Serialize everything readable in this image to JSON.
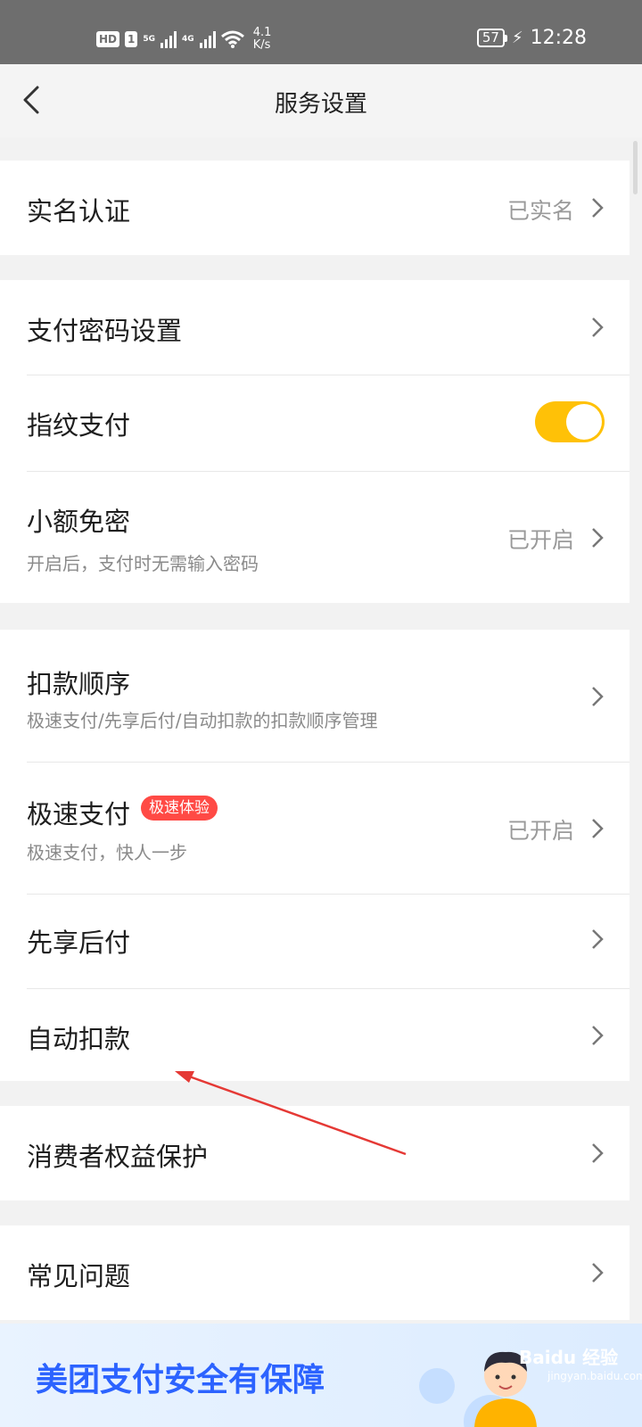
{
  "status_bar": {
    "hd": "HD",
    "sim": "1",
    "net1": "5G",
    "net2": "4G",
    "speed_value": "4.1",
    "speed_unit": "K/s",
    "battery": "57",
    "time": "12:28"
  },
  "header": {
    "title": "服务设置"
  },
  "rows": {
    "realname": {
      "label": "实名认证",
      "value": "已实名"
    },
    "pay_password": {
      "label": "支付密码设置"
    },
    "fingerprint": {
      "label": "指纹支付",
      "enabled": true
    },
    "small_free": {
      "label": "小额免密",
      "sub": "开启后，支付时无需输入密码",
      "value": "已开启"
    },
    "deduct_order": {
      "label": "扣款顺序",
      "sub": "极速支付/先享后付/自动扣款的扣款顺序管理"
    },
    "fast_pay": {
      "label": "极速支付",
      "badge": "极速体验",
      "sub": "极速支付，快人一步",
      "value": "已开启"
    },
    "enjoy_first": {
      "label": "先享后付"
    },
    "auto_deduct": {
      "label": "自动扣款"
    },
    "consumer": {
      "label": "消费者权益保护"
    },
    "faq": {
      "label": "常见问题"
    }
  },
  "banner": {
    "text": "美团支付安全有保障",
    "watermark": "Baidu 经验",
    "watermark_url": "jingyan.baidu.com"
  },
  "colors": {
    "toggle_on": "#ffc107",
    "badge": "#ff4a45",
    "banner_text": "#2c63ff",
    "annotation_arrow": "#e53935"
  }
}
